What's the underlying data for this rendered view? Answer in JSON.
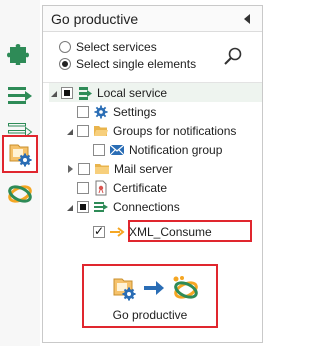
{
  "panel": {
    "title": "Go productive"
  },
  "options": {
    "select_services": "Select services",
    "select_single": "Select single elements",
    "selected": "select_single"
  },
  "tree": {
    "local_service": "Local service",
    "settings": "Settings",
    "groups_for_notifications": "Groups for notifications",
    "notification_group": "Notification group",
    "mail_server": "Mail server",
    "certificate": "Certificate",
    "connections": "Connections",
    "xml_consume": "XML_Consume"
  },
  "action": {
    "go_productive_label": "Go productive"
  },
  "rail": {
    "items": [
      "puzzle-icon",
      "lines-arrow-icon",
      "lines-arrow-outline-icon",
      "folder-gear-icon",
      "ring-icon"
    ],
    "selected": "folder-gear-icon"
  },
  "colors": {
    "highlight_red": "#e0262e",
    "green": "#2e8b57",
    "orange": "#f5a623",
    "blue": "#2a6db5"
  }
}
